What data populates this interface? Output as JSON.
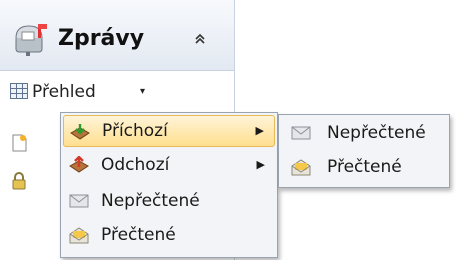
{
  "panel": {
    "title": "Zprávy",
    "collapse_symbol": "⌃⌃",
    "overview_label": "Přehled",
    "overview_arrow": "▾"
  },
  "menu": {
    "items": [
      {
        "label": "Příchozí",
        "submenu_arrow": "▶",
        "highlighted": true
      },
      {
        "label": "Odchozí",
        "submenu_arrow": "▶"
      },
      {
        "label": "Nepřečtené"
      },
      {
        "label": "Přečtené"
      }
    ]
  },
  "submenu": {
    "items": [
      {
        "label": "Nepřečtené"
      },
      {
        "label": "Přečtené"
      }
    ]
  },
  "icons": {
    "header": "mailbox-icon",
    "overview": "grid-icon",
    "side1": "document-icon",
    "side2": "lock-icon",
    "inbox": "inbox-tray-icon",
    "outbox": "outbox-tray-icon",
    "unread": "closed-envelope-icon",
    "read": "open-envelope-icon"
  },
  "colors": {
    "highlight": "#ffdf8e",
    "menu_bg": "#f3f4f7",
    "header_bg": "#e3e9f2"
  }
}
